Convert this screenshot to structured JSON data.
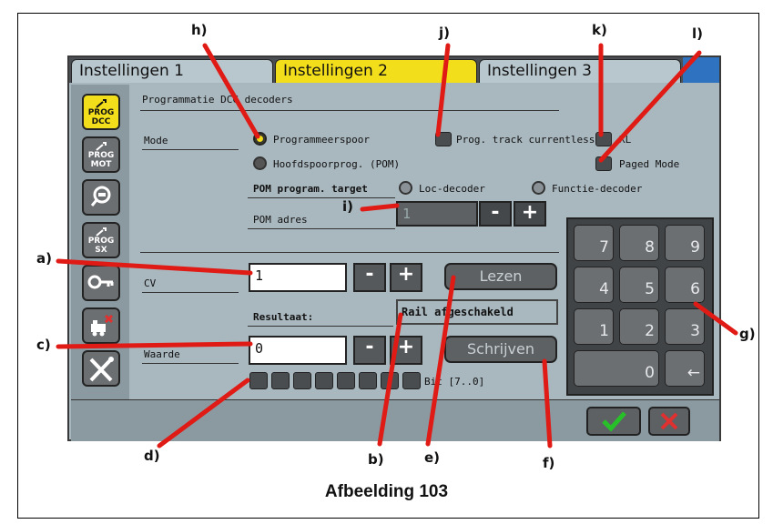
{
  "tabs": [
    {
      "label": "Instellingen 1",
      "active": false
    },
    {
      "label": "Instellingen 2",
      "active": true
    },
    {
      "label": "Instellingen 3",
      "active": false
    }
  ],
  "sidebar": {
    "items": [
      {
        "label": "PROG DCC",
        "icon": "wrench-icon",
        "active": true
      },
      {
        "label": "PROG MOT",
        "icon": "wrench-icon",
        "active": false
      },
      {
        "label": "",
        "icon": "magnifier-loco-icon",
        "active": false
      },
      {
        "label": "PROG SX",
        "icon": "wrench-icon",
        "active": false
      },
      {
        "label": "",
        "icon": "key-icon",
        "active": false
      },
      {
        "label": "",
        "icon": "loco-delete-icon",
        "active": false
      },
      {
        "label": "",
        "icon": "tools-icon",
        "active": false
      }
    ]
  },
  "panel": {
    "title": "Programmatie DCC decoders",
    "mode_label": "Mode",
    "mode_options": [
      {
        "label": "Programmeerspoor",
        "selected": true
      },
      {
        "label": "Hoofdspoorprog. (POM)",
        "selected": false
      }
    ],
    "checkboxes": {
      "currentless": "Prog. track currentless",
      "xl": "XL",
      "paged": "Paged Mode"
    },
    "pom_target_label": "POM program. target",
    "pom_target_options": [
      {
        "label": "Loc-decoder"
      },
      {
        "label": "Functie-decoder"
      }
    ],
    "pom_address_label": "POM adres",
    "pom_address_value": "1",
    "cv_label": "CV",
    "cv_value": "1",
    "result_label": "Resultaat:",
    "result_value": "Rail afgeschakeld",
    "value_label": "Waarde",
    "value_value": "0",
    "read_button": "Lezen",
    "write_button": "Schrijven",
    "bit_label": "Bit [7..0]",
    "minus": "-",
    "plus": "+"
  },
  "keypad": {
    "keys": [
      "7",
      "8",
      "9",
      "4",
      "5",
      "6",
      "1",
      "2",
      "3",
      "0",
      "←"
    ]
  },
  "bottom": {
    "ok_icon": "check-icon",
    "cancel_icon": "x-icon"
  },
  "callouts": {
    "a": "a)",
    "b": "b)",
    "c": "c)",
    "d": "d)",
    "e": "e)",
    "f": "f)",
    "g": "g)",
    "h": "h)",
    "i": "i)",
    "j": "j)",
    "k": "k)",
    "l": "l)"
  },
  "caption": "Afbeelding 103",
  "colors": {
    "active_tab": "#f3de1b",
    "panel": "#a9b7be",
    "callout_line": "#e01a14",
    "check_green": "#28c028",
    "cancel_red": "#e03030"
  }
}
